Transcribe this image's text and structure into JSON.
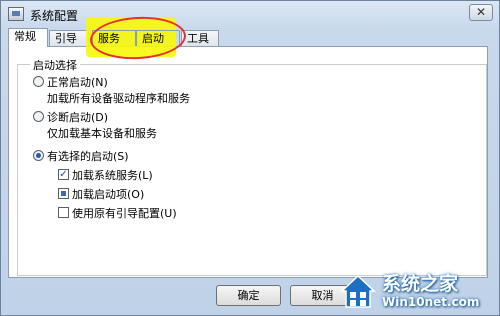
{
  "window": {
    "title": "系统配置",
    "close_glyph": "✕"
  },
  "tabs": [
    {
      "label": "常规",
      "active": true
    },
    {
      "label": "引导",
      "active": false
    },
    {
      "label": "服务",
      "active": false
    },
    {
      "label": "启动",
      "active": false
    },
    {
      "label": "工具",
      "active": false
    }
  ],
  "group": {
    "legend": "启动选择",
    "options": [
      {
        "label": "正常启动(N)",
        "description": "加载所有设备驱动程序和服务",
        "selected": false
      },
      {
        "label": "诊断启动(D)",
        "description": "仅加载基本设备和服务",
        "selected": false
      },
      {
        "label": "有选择的启动(S)",
        "selected": true
      }
    ],
    "sub_options": [
      {
        "label": "加载系统服务(L)",
        "state": "checked"
      },
      {
        "label": "加载启动项(O)",
        "state": "mixed"
      },
      {
        "label": "使用原有引导配置(U)",
        "state": "unchecked"
      }
    ]
  },
  "buttons": {
    "ok": "确定",
    "cancel": "取消"
  },
  "watermark": {
    "brand": "系统之家",
    "site": "Win10net.com"
  },
  "colors": {
    "highlight": "#f6f80c",
    "annotation": "#e53030",
    "accent": "#2b5aa8"
  }
}
